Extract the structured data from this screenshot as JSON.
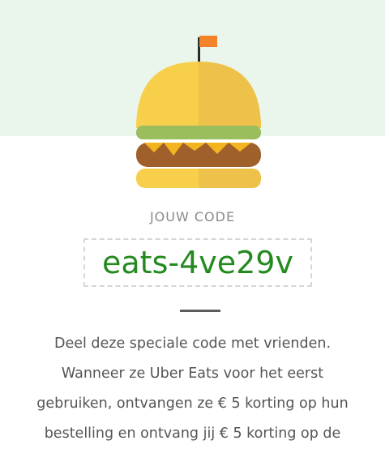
{
  "referral": {
    "code_label": "JOUW CODE",
    "code": "eats-4ve29v",
    "description_lines": [
      "Deel deze speciale code met vrienden.",
      "Wanneer ze Uber Eats voor het eerst",
      "gebruiken, ontvangen ze € 5 korting op hun",
      "bestelling en ontvang jij € 5 korting op de"
    ]
  },
  "illustration": {
    "icon": "burger-illustration",
    "colors": {
      "bun": "#f7cf4b",
      "bun_shadow": "#eebc3d",
      "lettuce": "#9bbd5e",
      "patty": "#a0602b",
      "cheese": "#f2b51f",
      "flag": "#f5832a",
      "pole": "#2b2b2b"
    }
  },
  "colors": {
    "hero_background": "#eaf6ec",
    "code_text": "#238a1f",
    "label_text": "#8a8a8a",
    "body_text": "#555555",
    "divider": "#5c5c5c"
  }
}
